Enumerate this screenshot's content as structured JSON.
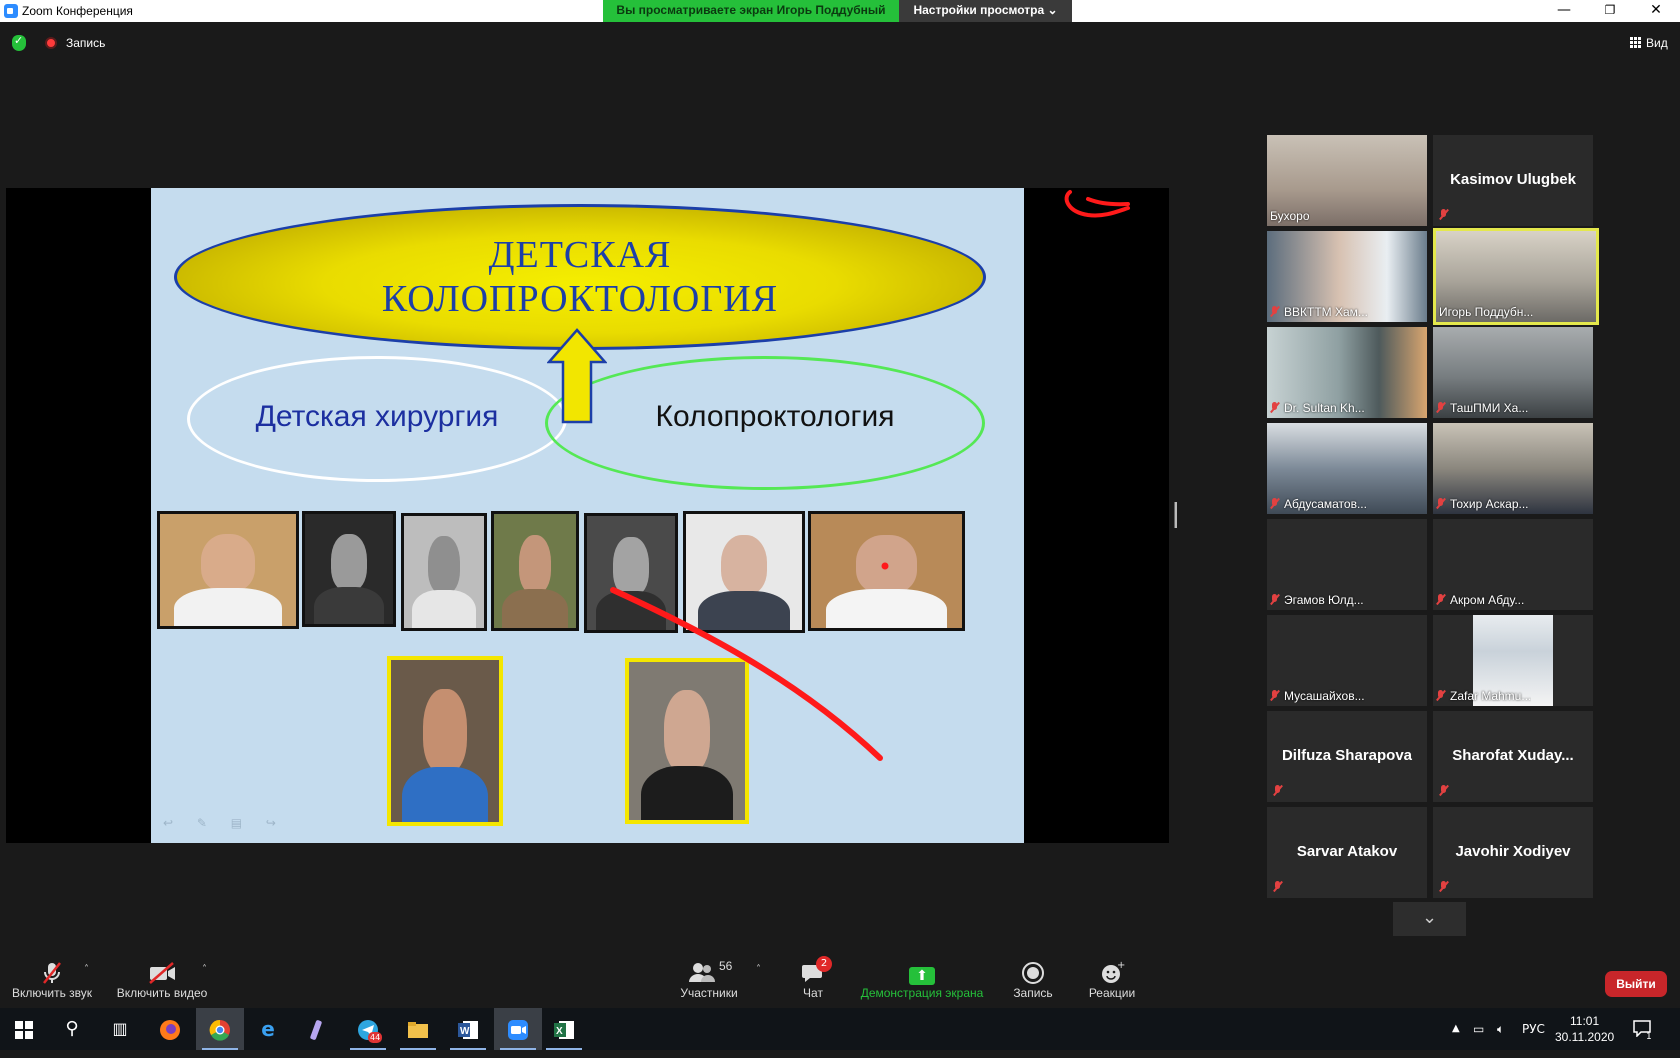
{
  "window": {
    "title": "Zoom Конференция",
    "share_banner": "Вы просматриваете экран Игорь Поддубный",
    "view_settings": "Настройки просмотра",
    "chevron": "⌄",
    "minimize": "—",
    "maximize": "❐",
    "close": "✕"
  },
  "meeting_bar": {
    "recording_label": "Запись",
    "view_label": "Вид"
  },
  "slide": {
    "title_line1": "ДЕТСКАЯ",
    "title_line2": "КОЛОПРОКТОЛОГИЯ",
    "left_label": "Детская хирургия",
    "right_label": "Колопроктология",
    "tools": "↩ ✎ ▤ ↪"
  },
  "gallery": {
    "participants": [
      {
        "name": "Бухоро",
        "video": true,
        "muted": false,
        "bg": "#b7aaa0"
      },
      {
        "name": "Kasimov Ulugbek",
        "video": false,
        "muted": true
      },
      {
        "name": "ВВКТТМ Хам...",
        "video": true,
        "muted": true,
        "bg": "#6b7d8c"
      },
      {
        "name": "Игорь Поддубн...",
        "video": true,
        "muted": false,
        "active": true,
        "bg": "#a9a49a"
      },
      {
        "name": "Dr. Sultan Kh...",
        "video": true,
        "muted": true,
        "bg": "#8fa0a2"
      },
      {
        "name": "ТашПМИ Ха...",
        "video": true,
        "muted": true,
        "bg": "#777d80"
      },
      {
        "name": "Абдусаматов...",
        "video": true,
        "muted": true,
        "bg": "#7d8a98"
      },
      {
        "name": "Тохир Аскар...",
        "video": true,
        "muted": true,
        "bg": "#8b877e"
      },
      {
        "name": "Эгамов Юлд...",
        "video": false,
        "muted": true,
        "label_bottom": true
      },
      {
        "name": "Акром Абду...",
        "video": false,
        "muted": true,
        "label_bottom": true
      },
      {
        "name": "Мусашайхов...",
        "video": false,
        "muted": true,
        "label_bottom": true
      },
      {
        "name": "Zafar Mahmu...",
        "video": true,
        "muted": true,
        "bg": "#c9d2da"
      },
      {
        "name": "Dilfuza Sharapova",
        "video": false,
        "muted": true
      },
      {
        "name": "Sharofat  Xuday...",
        "video": false,
        "muted": true
      },
      {
        "name": "Sarvar Atakov",
        "video": false,
        "muted": true
      },
      {
        "name": "Javohir Xodiyev",
        "video": false,
        "muted": true
      }
    ],
    "next_page": "⌄"
  },
  "toolbar": {
    "unmute_label": "Включить звук",
    "video_label": "Включить видео",
    "participants_label": "Участники",
    "participants_count": "56",
    "chat_label": "Чат",
    "chat_badge": "2",
    "share_label": "Демонстрация экрана",
    "record_label": "Запись",
    "reactions_label": "Реакции",
    "leave_label": "Выйти",
    "caret": "˄"
  },
  "taskbar": {
    "telegram_badge": "44",
    "language": "РУС",
    "time": "11:01",
    "date": "30.11.2020",
    "notifications_count": "1"
  },
  "colors": {
    "share_green": "#25c03a",
    "leave_red": "#c8262a",
    "active_speaker": "#e4e84c",
    "slide_bg": "#c5dcee",
    "title_blue": "#1c3fa8",
    "annotation_red": "#ff1a1a"
  }
}
